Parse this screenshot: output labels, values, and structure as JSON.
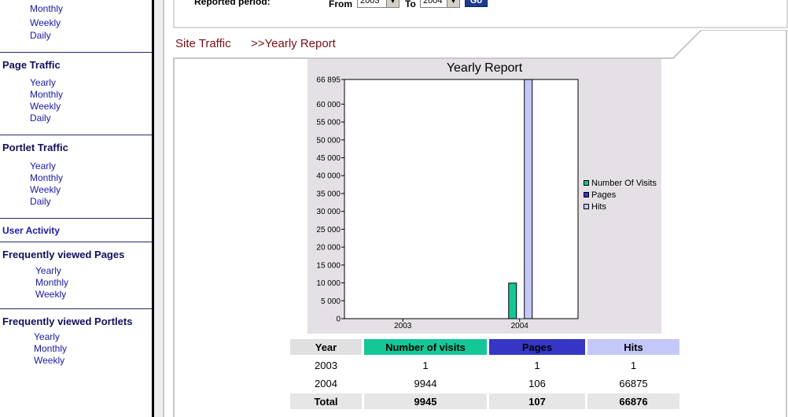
{
  "sidebar": {
    "top_links": [
      "Monthly",
      "Weekly",
      "Daily"
    ],
    "sections": [
      {
        "title": "Page Traffic",
        "links": [
          "Yearly",
          "Monthly",
          "Weekly",
          "Daily"
        ]
      },
      {
        "title": "Portlet Traffic",
        "links": [
          "Yearly",
          "Monthly",
          "Weekly",
          "Daily"
        ]
      },
      {
        "title": "User Activity",
        "links": []
      },
      {
        "title": "Frequently viewed Pages",
        "links": [
          "Yearly",
          "Monthly",
          "Weekly"
        ]
      },
      {
        "title": "Frequently viewed Portlets",
        "links": [
          "Yearly",
          "Monthly",
          "Weekly"
        ]
      }
    ]
  },
  "filter": {
    "period_label": "Reported period:",
    "from_label": "From",
    "from_value": "2003",
    "to_label": "To",
    "to_value": "2004",
    "go_label": "Go"
  },
  "breadcrumb": {
    "section": "Site Traffic",
    "page": ">>Yearly  Report"
  },
  "chart_data": {
    "type": "bar",
    "title": "Yearly Report",
    "categories": [
      "2003",
      "2004"
    ],
    "series": [
      {
        "name": "Number Of Visits",
        "color": "#14c896",
        "values": [
          1,
          9944
        ]
      },
      {
        "name": "Pages",
        "color": "#3535c6",
        "values": [
          1,
          106
        ]
      },
      {
        "name": "Hits",
        "color": "#c4c8f8",
        "values": [
          1,
          66875
        ]
      }
    ],
    "ylim": [
      0,
      66895
    ],
    "y_top_label": "66 895",
    "yticks": [
      0,
      5000,
      10000,
      15000,
      20000,
      25000,
      30000,
      35000,
      40000,
      45000,
      50000,
      55000,
      60000
    ],
    "ytick_labels": [
      "0",
      "5 000",
      "10 000",
      "15 000",
      "20 000",
      "25 000",
      "30 000",
      "35 000",
      "40 000",
      "45 000",
      "50 000",
      "55 000",
      "60 000"
    ],
    "legend": "right",
    "grid": false
  },
  "table": {
    "headers": [
      "Year",
      "Number of visits",
      "Pages",
      "Hits"
    ],
    "rows": [
      [
        "2003",
        "1",
        "1",
        "1"
      ],
      [
        "2004",
        "9944",
        "106",
        "66875"
      ]
    ],
    "total": [
      "Total",
      "9945",
      "107",
      "66876"
    ]
  },
  "colors": {
    "visits": "#14c896",
    "pages": "#3535c6",
    "hits": "#c4c8f8",
    "breadcrumb": "#7a0f12",
    "sidebar_link": "#1a1aa8"
  }
}
